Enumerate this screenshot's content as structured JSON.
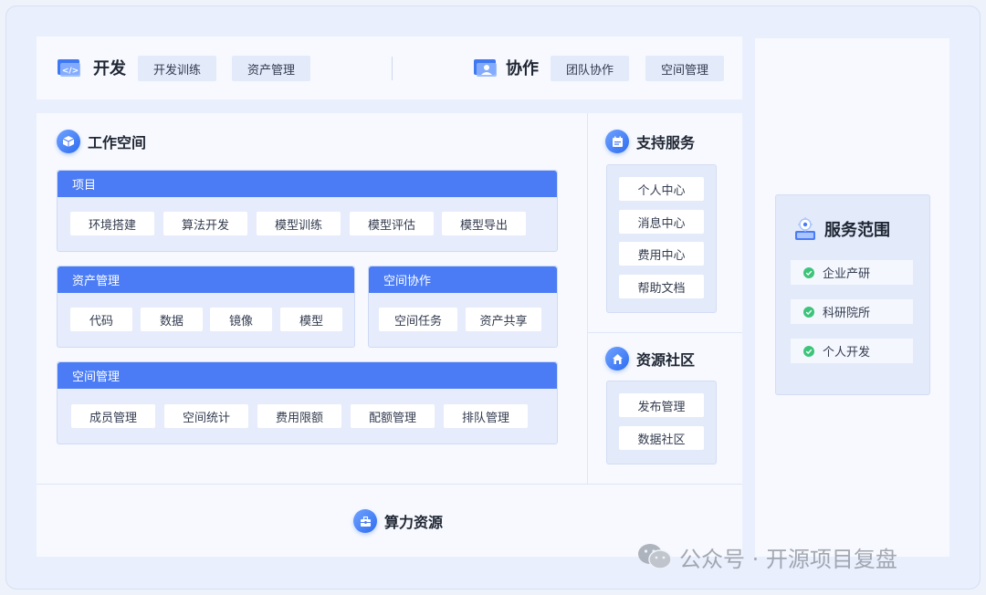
{
  "top_bar": {
    "dev": {
      "label": "开发",
      "chips": [
        "开发训练",
        "资产管理"
      ]
    },
    "collab": {
      "label": "协作",
      "chips": [
        "团队协作",
        "空间管理"
      ]
    }
  },
  "workspace": {
    "title": "工作空间",
    "project": {
      "header": "项目",
      "items": [
        "环境搭建",
        "算法开发",
        "模型训练",
        "模型评估",
        "模型导出"
      ]
    },
    "assets": {
      "header": "资产管理",
      "items": [
        "代码",
        "数据",
        "镜像",
        "模型"
      ]
    },
    "space_collab": {
      "header": "空间协作",
      "items": [
        "空间任务",
        "资产共享"
      ]
    },
    "space_mgmt": {
      "header": "空间管理",
      "items": [
        "成员管理",
        "空间统计",
        "费用限额",
        "配额管理",
        "排队管理"
      ]
    }
  },
  "support": {
    "title": "支持服务",
    "items": [
      "个人中心",
      "消息中心",
      "费用中心",
      "帮助文档"
    ]
  },
  "community": {
    "title": "资源社区",
    "items": [
      "发布管理",
      "数据社区"
    ]
  },
  "compute": {
    "title": "算力资源"
  },
  "scope": {
    "title": "服务范围",
    "items": [
      "企业产研",
      "科研院所",
      "个人开发"
    ]
  },
  "watermark": {
    "text": "公众号 · 开源项目复盘"
  },
  "colors": {
    "accent": "#4b7cf5",
    "check": "#3cc47a",
    "background": "#e9effc"
  }
}
